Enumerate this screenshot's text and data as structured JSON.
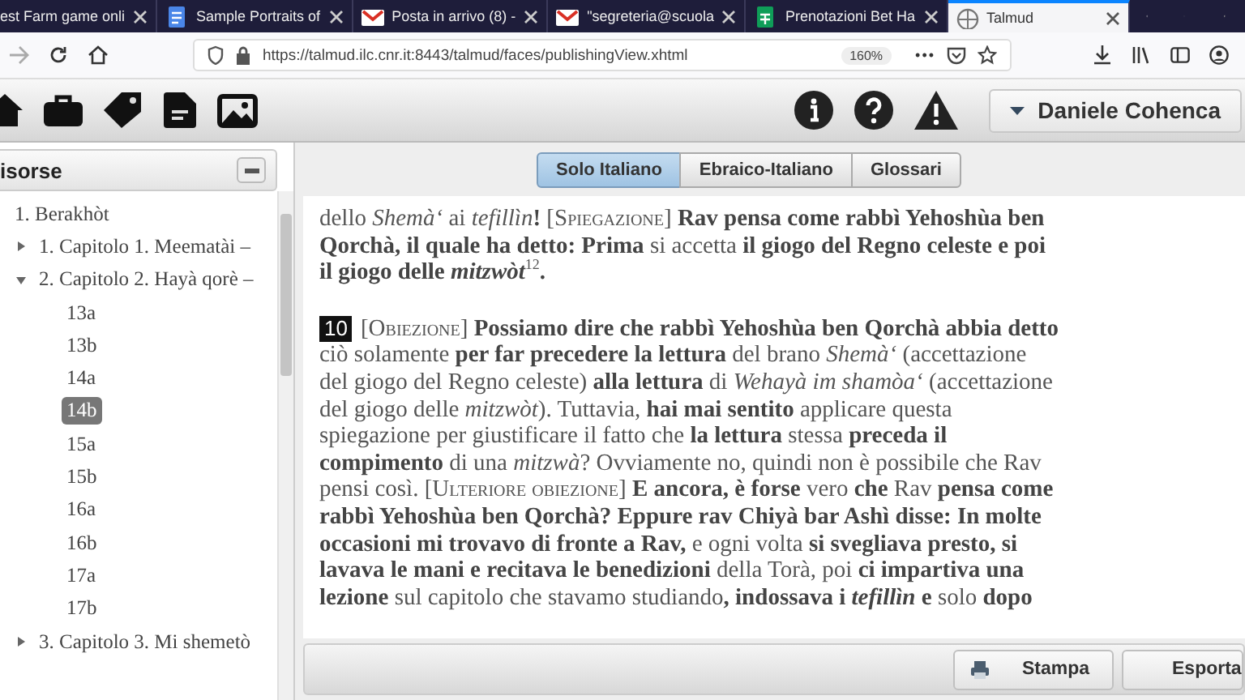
{
  "browser": {
    "tabs": [
      {
        "title": "est Farm game onli",
        "selected": false
      },
      {
        "title": "Sample Portraits of",
        "selected": false
      },
      {
        "title": "Posta in arrivo (8) -",
        "selected": false
      },
      {
        "title": "\"segreteria@scuola",
        "selected": false
      },
      {
        "title": "Prenotazioni Bet Ha",
        "selected": false
      },
      {
        "title": "Talmud",
        "selected": true
      }
    ],
    "url": "https://talmud.ilc.cnr.it:8443/talmud/faces/publishingView.xhtml",
    "zoom": "160%",
    "more": "•••"
  },
  "user_menu": {
    "label": "Daniele Cohenca"
  },
  "sidebar": {
    "title": "isorse",
    "tree": [
      {
        "label": "1. Berakhòt",
        "selected": false,
        "children": [
          {
            "label": "1. Capitolo 1. Meematài –",
            "expanded": false,
            "selected": false
          },
          {
            "label": "2. Capitolo 2. Hayà qorè –",
            "expanded": true,
            "selected": false,
            "children": [
              {
                "label": "13a",
                "selected": false
              },
              {
                "label": "13b",
                "selected": false
              },
              {
                "label": "14a",
                "selected": false
              },
              {
                "label": "14b",
                "selected": true
              },
              {
                "label": "15a",
                "selected": false
              },
              {
                "label": "15b",
                "selected": false
              },
              {
                "label": "16a",
                "selected": false
              },
              {
                "label": "16b",
                "selected": false
              },
              {
                "label": "17a",
                "selected": false
              },
              {
                "label": "17b",
                "selected": false
              }
            ]
          },
          {
            "label": "3. Capitolo 3. Mi shemetò",
            "expanded": false,
            "selected": false
          }
        ]
      }
    ]
  },
  "view_tabs": [
    {
      "label": "Solo Italiano",
      "selected": true
    },
    {
      "label": "Ebraico-Italiano",
      "selected": false
    },
    {
      "label": "Glossari",
      "selected": false
    }
  ],
  "paragraphs": [
    {
      "segments": [
        {
          "kind": "plain",
          "t": "dello "
        },
        {
          "kind": "italic",
          "t": "Shemà‘"
        },
        {
          "kind": "plain",
          "t": " ai "
        },
        {
          "kind": "italic",
          "t": "tefillìn"
        },
        {
          "kind": "bold",
          "t": "! "
        },
        {
          "kind": "small_caps",
          "t": "[Spiegazione]"
        },
        {
          "kind": "bold",
          "t": " Rav pensa come rabbì Yehoshùa ben Qorchà, il quale ha detto: Prima"
        },
        {
          "kind": "plain",
          "t": " si accetta "
        },
        {
          "kind": "bold",
          "t": "il giogo del Regno celeste e poi il giogo delle "
        },
        {
          "kind": "bold_italic",
          "t": "mitzwòt"
        },
        {
          "kind": "superscript",
          "t": "12"
        },
        {
          "kind": "bold",
          "t": "."
        }
      ]
    },
    {
      "number": "10",
      "segments": [
        {
          "kind": "small_caps",
          "t": "[Obiezione]"
        },
        {
          "kind": "bold",
          "t": " Possiamo dire che rabbì Yehoshùa ben Qorchà abbia detto"
        },
        {
          "kind": "plain",
          "t": " ciò solamente "
        },
        {
          "kind": "bold",
          "t": "per far precedere la lettura"
        },
        {
          "kind": "plain",
          "t": " del brano "
        },
        {
          "kind": "italic",
          "t": "Shemà‘"
        },
        {
          "kind": "plain",
          "t": " (accettazione del giogo del Regno celeste) "
        },
        {
          "kind": "bold",
          "t": "alla lettura"
        },
        {
          "kind": "plain",
          "t": " di "
        },
        {
          "kind": "italic",
          "t": "Wehayà im shamòa‘"
        },
        {
          "kind": "plain",
          "t": " (accettazione del giogo delle "
        },
        {
          "kind": "italic",
          "t": "mitzwòt"
        },
        {
          "kind": "plain",
          "t": "). Tuttavia, "
        },
        {
          "kind": "bold",
          "t": "hai mai sentito"
        },
        {
          "kind": "plain",
          "t": " applicare questa spiegazione per giustificare il fatto che "
        },
        {
          "kind": "bold",
          "t": "la lettura"
        },
        {
          "kind": "plain",
          "t": " stessa "
        },
        {
          "kind": "bold",
          "t": "preceda il compimento"
        },
        {
          "kind": "plain",
          "t": " di una "
        },
        {
          "kind": "italic",
          "t": "mitzwà"
        },
        {
          "kind": "plain",
          "t": "? Ovviamente no, quindi non è possibile che Rav pensi così. "
        },
        {
          "kind": "small_caps",
          "t": "[Ulteriore obiezione]"
        },
        {
          "kind": "bold",
          "t": " E ancora, è forse"
        },
        {
          "kind": "plain",
          "t": " vero "
        },
        {
          "kind": "bold",
          "t": "che"
        },
        {
          "kind": "plain",
          "t": " Rav "
        },
        {
          "kind": "bold",
          "t": "pensa come rabbì Yehoshùa ben Qorchà? Eppure rav Chiyà bar Ashì disse: In molte occasioni mi trovavo di fronte a Rav,"
        },
        {
          "kind": "plain",
          "t": " e ogni volta "
        },
        {
          "kind": "bold",
          "t": "si svegliava presto, si lavava le mani e recitava le benedizioni"
        },
        {
          "kind": "plain",
          "t": " della Torà, poi "
        },
        {
          "kind": "bold",
          "t": "ci impartiva una lezione"
        },
        {
          "kind": "plain",
          "t": " sul capitolo che stavamo studiando"
        },
        {
          "kind": "bold",
          "t": ", indossava i "
        },
        {
          "kind": "bold_italic",
          "t": "tefillìn"
        },
        {
          "kind": "bold",
          "t": " e"
        },
        {
          "kind": "plain",
          "t": " solo "
        },
        {
          "kind": "bold",
          "t": "dopo"
        }
      ]
    }
  ],
  "footer_buttons": [
    {
      "label": "Stampa",
      "kind": "print"
    },
    {
      "label": "Esporta",
      "kind": "menu"
    }
  ]
}
